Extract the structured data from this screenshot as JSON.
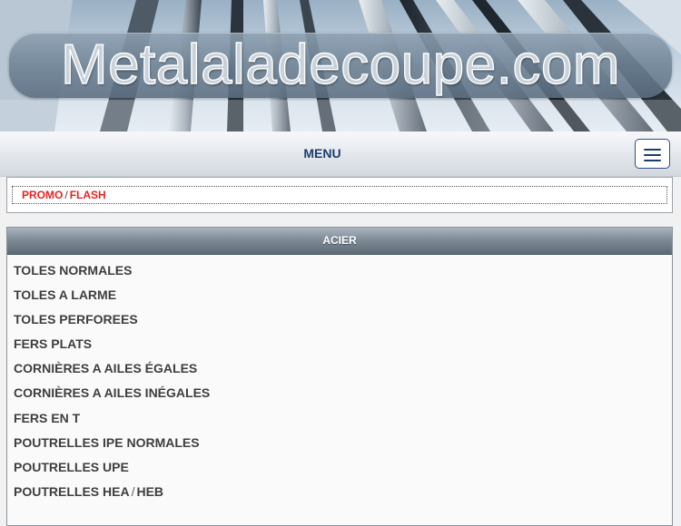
{
  "header": {
    "site_title": "Metalaladecoupe.com"
  },
  "nav": {
    "menu_label": "MENU"
  },
  "promo": {
    "part1": "PROMO",
    "separator": "/",
    "part2": "FLASH"
  },
  "section": {
    "title": "ACIER",
    "items": [
      {
        "label": "TOLES NORMALES"
      },
      {
        "label": "TOLES A LARME"
      },
      {
        "label": "TOLES PERFOREES"
      },
      {
        "label": "FERS PLATS"
      },
      {
        "label": "CORNIÈRES A AILES ÉGALES"
      },
      {
        "label": "CORNIÈRES A AILES INÉGALES"
      },
      {
        "label": "FERS EN T"
      },
      {
        "label": "POUTRELLES IPE NORMALES"
      },
      {
        "label": "POUTRELLES UPE"
      },
      {
        "label": "POUTRELLES HEA",
        "separator": "/",
        "label2": "HEB"
      }
    ]
  },
  "colors": {
    "menu_text": "#1d3c6e",
    "promo_text": "#e8231f",
    "item_text": "#3e3e3e"
  }
}
